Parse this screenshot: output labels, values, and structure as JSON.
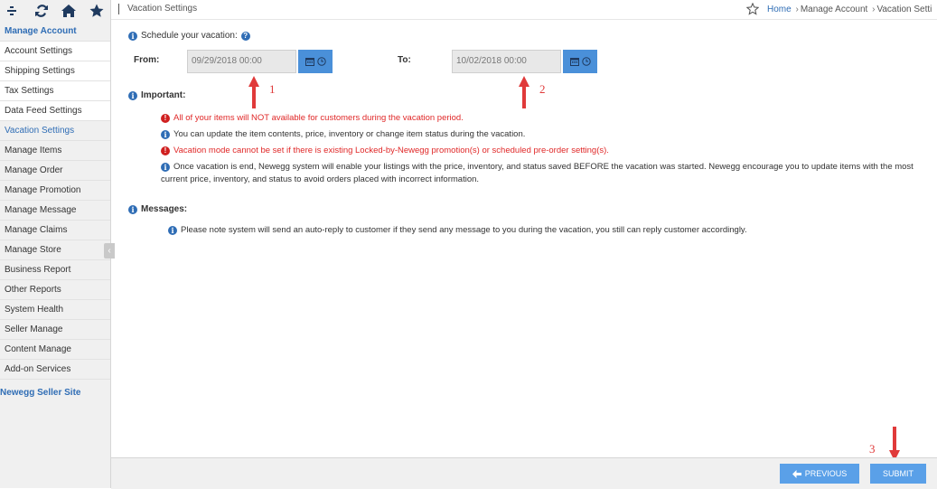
{
  "sidebar": {
    "icons": [
      "menu-icon",
      "refresh-icon",
      "home-icon",
      "star-icon"
    ],
    "section_title": "Manage Account",
    "sub_items": [
      {
        "label": "Account Settings"
      },
      {
        "label": "Shipping Settings"
      },
      {
        "label": "Tax Settings"
      },
      {
        "label": "Data Feed Settings"
      }
    ],
    "active_item": "Vacation Settings",
    "items": [
      {
        "label": "Manage Items"
      },
      {
        "label": "Manage Order"
      },
      {
        "label": "Manage Promotion"
      },
      {
        "label": "Manage Message"
      },
      {
        "label": "Manage Claims"
      },
      {
        "label": "Manage Store"
      },
      {
        "label": "Business Report"
      },
      {
        "label": "Other Reports"
      },
      {
        "label": "System Health"
      },
      {
        "label": "Seller Manage"
      },
      {
        "label": "Content Manage"
      },
      {
        "label": "Add-on Services"
      }
    ],
    "site_link": "Newegg Seller Site",
    "collapse_glyph": "‹"
  },
  "header": {
    "title": "Vacation Settings",
    "breadcrumb": {
      "home": "Home",
      "level1": "Manage Account",
      "level2": "Vacation Setti"
    }
  },
  "schedule": {
    "label": "Schedule your vacation:",
    "from_label": "From:",
    "from_value": "09/29/2018 00:00",
    "to_label": "To:",
    "to_value": "10/02/2018 00:00"
  },
  "important": {
    "title": "Important:",
    "items": [
      {
        "text": "All of your items will NOT available for customers during the vacation period."
      },
      {
        "text": "You can update the item contents, price, inventory or change item status during the vacation."
      },
      {
        "text": "Vacation mode cannot be set if there is existing Locked-by-Newegg promotion(s) or scheduled pre-order setting(s)."
      },
      {
        "text": "Once vacation is end, Newegg system will enable your listings with the price, inventory, and status saved BEFORE the vacation was started. Newegg encourage you to update items with the most"
      }
    ],
    "item4_continued": "current price, inventory, and status to avoid orders placed with incorrect information."
  },
  "messages": {
    "title": "Messages:",
    "text": "Please note system will send an auto-reply to customer if they send any message to you during the vacation, you still can reply customer accordingly."
  },
  "annotations": [
    "1",
    "2",
    "3"
  ],
  "footer": {
    "previous_label": "PREVIOUS",
    "submit_label": "SUBMIT"
  },
  "colors": {
    "accent_blue": "#2f6db5",
    "button_blue": "#5aa0e8",
    "warning_red": "#e02828",
    "annotation_red": "#e03a3a"
  }
}
